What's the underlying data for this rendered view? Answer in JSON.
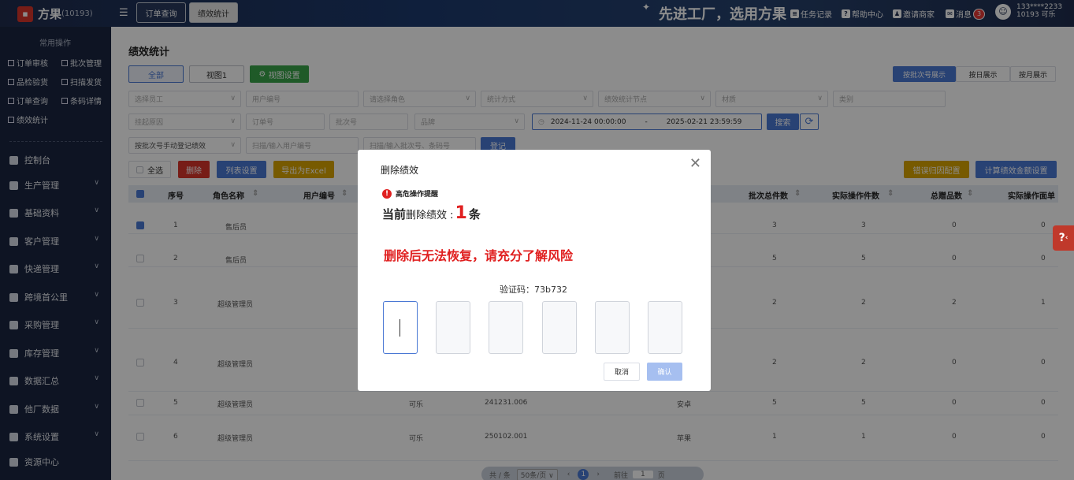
{
  "app": {
    "name": "方果",
    "id": "(10193)"
  },
  "top_tabs": [
    "订单查询",
    "绩效统计"
  ],
  "slogan": "先进工厂，选用方果",
  "top_links": {
    "tasks": "任务记录",
    "help": "帮助中心",
    "invite": "邀请商家",
    "messages": "消息",
    "message_count": "3"
  },
  "user": {
    "phone": "133****2233",
    "line2": "10193  可乐"
  },
  "sidebar": {
    "header": "常用操作",
    "quick": [
      "订单审核",
      "批次管理",
      "品检验货",
      "扫描发货",
      "订单查询",
      "条码详情",
      "绩效统计"
    ],
    "nav": [
      "控制台",
      "生产管理",
      "基础资料",
      "客户管理",
      "快递管理",
      "跨境首公里",
      "采购管理",
      "库存管理",
      "数据汇总",
      "他厂数据",
      "系统设置",
      "资源中心"
    ]
  },
  "page": {
    "title": "绩效统计",
    "view_buttons": {
      "all": "全部",
      "view1": "视图1",
      "view_settings": "视图设置"
    },
    "display_modes": [
      "按批次号展示",
      "按日展示",
      "按月展示"
    ],
    "filters_row1": [
      "选择员工",
      "用户编号",
      "请选择角色",
      "统计方式",
      "绩效统计节点",
      "材质",
      "类别"
    ],
    "filters_row2": [
      "挂起原因",
      "订单号",
      "批次号",
      "品牌"
    ],
    "date_start": "2024-11-24 00:00:00",
    "date_sep": "-",
    "date_end": "2025-02-21 23:59:59",
    "search": "搜索",
    "filters_row3": [
      "按批次号手动登记绩效",
      "扫描/输入用户编号",
      "扫描/输入批次号、条码号"
    ],
    "register": "登记",
    "select_all": "全选",
    "delete": "删除",
    "column_settings": "列表设置",
    "export": "导出为Excel",
    "error_config": "错误归因配置",
    "calc_settings": "计算绩效金额设置"
  },
  "table": {
    "headers": [
      "序号",
      "角色名称",
      "用户编号",
      "批次总件数",
      "实际操作件数",
      "总赠品数",
      "实际操作面单"
    ],
    "rows": [
      {
        "no": "1",
        "role": "售后员",
        "user": "",
        "batch": "",
        "brand": "",
        "total": "3",
        "actual": "3",
        "gift": "0",
        "face": "0",
        "checked": true
      },
      {
        "no": "2",
        "role": "售后员",
        "user": "",
        "batch": "",
        "brand": "",
        "total": "5",
        "actual": "5",
        "gift": "0",
        "face": "0",
        "checked": false
      },
      {
        "no": "3",
        "role": "超级管理员",
        "user": "",
        "batch": "",
        "brand": "",
        "total": "2",
        "actual": "2",
        "gift": "2",
        "face": "1",
        "checked": false
      },
      {
        "no": "4",
        "role": "超级管理员",
        "user": "",
        "batch": "",
        "brand": "",
        "total": "2",
        "actual": "2",
        "gift": "0",
        "face": "0",
        "checked": false
      },
      {
        "no": "5",
        "role": "超级管理员",
        "user": "可乐",
        "batch": "241231.006",
        "brand": "安卓",
        "total": "5",
        "actual": "5",
        "gift": "0",
        "face": "0",
        "checked": false
      },
      {
        "no": "6",
        "role": "超级管理员",
        "user": "可乐",
        "batch": "250102.001",
        "brand": "苹果",
        "total": "1",
        "actual": "1",
        "gift": "0",
        "face": "0",
        "checked": false
      }
    ]
  },
  "pager": {
    "total": "共 / 条",
    "size": "50条/页",
    "current": "1",
    "goto": "前往",
    "page": "1",
    "unit": "页"
  },
  "dialog": {
    "title": "删除绩效",
    "warning": "高危操作提醒",
    "current_prefix": "当前",
    "current_mid": "删除绩效 :",
    "count": "1",
    "suffix": "条",
    "risk": "删除后无法恢复，请充分了解风险",
    "code_label": "验证码：73b732",
    "cancel": "取消",
    "confirm": "确认"
  },
  "help_tab": "?",
  "colors": {
    "primary": "#4a78d4",
    "danger": "#e02020",
    "green": "#3aa54a",
    "gold": "#d9a400",
    "sidebar": "#1b2640"
  }
}
